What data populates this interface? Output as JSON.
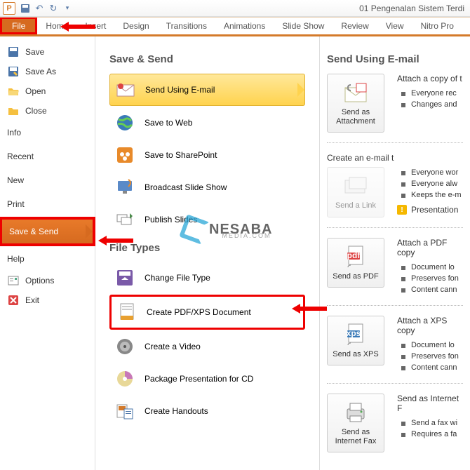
{
  "titlebar": {
    "doc_title": "01 Pengenalan Sistem Terdi"
  },
  "tabs": {
    "file": "File",
    "home": "Home",
    "insert": "Insert",
    "design": "Design",
    "transitions": "Transitions",
    "animations": "Animations",
    "slideshow": "Slide Show",
    "review": "Review",
    "view": "View",
    "nitro": "Nitro Pro"
  },
  "sidebar": {
    "save": "Save",
    "saveas": "Save As",
    "open": "Open",
    "close": "Close",
    "info": "Info",
    "recent": "Recent",
    "new": "New",
    "print": "Print",
    "savesend": "Save & Send",
    "help": "Help",
    "options": "Options",
    "exit": "Exit"
  },
  "middle": {
    "section1": "Save & Send",
    "email": "Send Using E-mail",
    "web": "Save to Web",
    "sharepoint": "Save to SharePoint",
    "broadcast": "Broadcast Slide Show",
    "publish": "Publish Slides",
    "section2": "File Types",
    "changetype": "Change File Type",
    "pdfxps": "Create PDF/XPS Document",
    "video": "Create a Video",
    "package": "Package Presentation for CD",
    "handouts": "Create Handouts"
  },
  "right": {
    "heading": "Send Using E-mail",
    "attach": {
      "btn": "Send as Attachment",
      "title": "Attach a copy of t",
      "b1": "Everyone rec",
      "b2": "Changes and"
    },
    "link": {
      "btn": "Send a Link",
      "title": "Create an e-mail t",
      "b1": "Everyone wor",
      "b2": "Everyone alw",
      "b3": "Keeps the e-m",
      "warn": "Presentation"
    },
    "pdf": {
      "btn": "Send as PDF",
      "title": "Attach a PDF copy",
      "b1": "Document lo",
      "b2": "Preserves fon",
      "b3": "Content cann"
    },
    "xps": {
      "btn": "Send as XPS",
      "title": "Attach a XPS copy",
      "b1": "Document lo",
      "b2": "Preserves fon",
      "b3": "Content cann"
    },
    "fax": {
      "btn": "Send as Internet Fax",
      "title": "Send as Internet F",
      "b1": "Send a fax wi",
      "b2": "Requires a fa"
    }
  },
  "watermark": {
    "text": "NESABA",
    "sub": "MEDIA.COM"
  }
}
